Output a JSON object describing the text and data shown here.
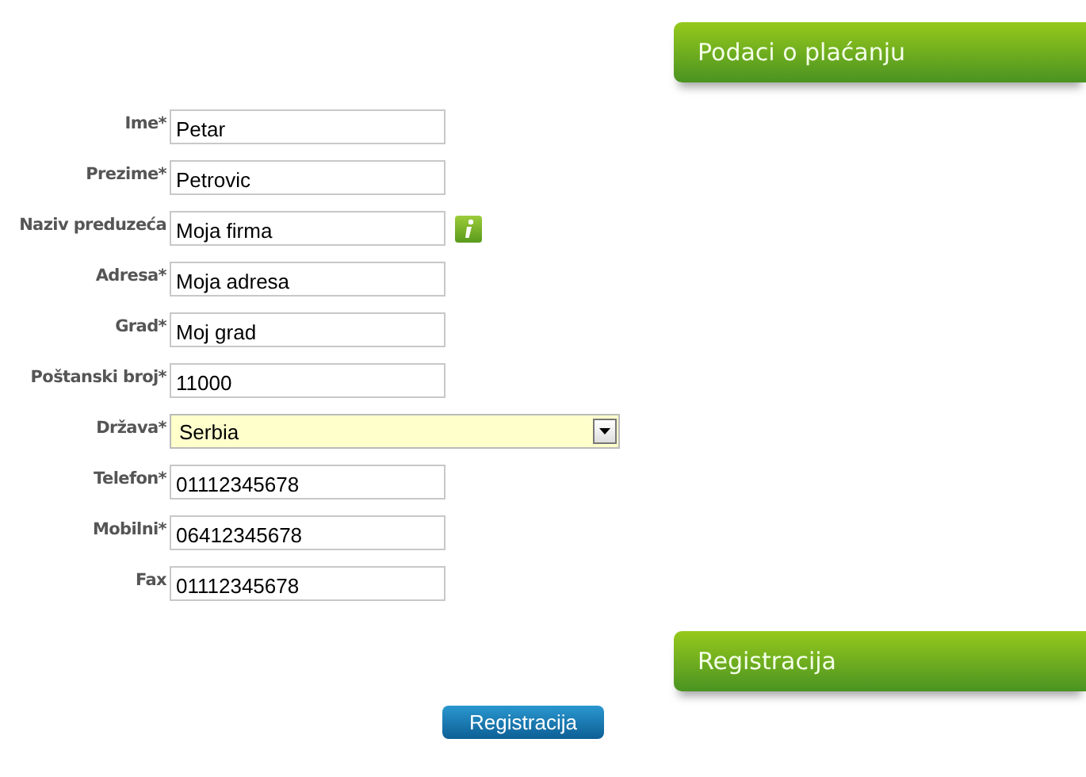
{
  "payment_header": {
    "title": "Podaci o plaćanju"
  },
  "fields": [
    {
      "kind": "text",
      "label": "Ime*",
      "value": "Petar",
      "info": false
    },
    {
      "kind": "text",
      "label": "Prezime*",
      "value": "Petrovic",
      "info": false
    },
    {
      "kind": "text",
      "label": "Naziv preduzeća",
      "value": "Moja firma",
      "info": true
    },
    {
      "kind": "text",
      "label": "Adresa*",
      "value": "Moja adresa",
      "info": false
    },
    {
      "kind": "text",
      "label": "Grad*",
      "value": "Moj grad",
      "info": false
    },
    {
      "kind": "text",
      "label": "Poštanski broj*",
      "value": "11000",
      "info": false
    },
    {
      "kind": "select",
      "label": "Država*",
      "value": "Serbia",
      "info": false
    },
    {
      "kind": "text",
      "label": "Telefon*",
      "value": "01112345678",
      "info": false
    },
    {
      "kind": "text",
      "label": "Mobilni*",
      "value": "06412345678",
      "info": false
    },
    {
      "kind": "text",
      "label": "Fax",
      "value": "01112345678",
      "info": false
    }
  ],
  "registration_header": {
    "title": "Registracija"
  },
  "submit_button": {
    "label": "Registracija"
  }
}
